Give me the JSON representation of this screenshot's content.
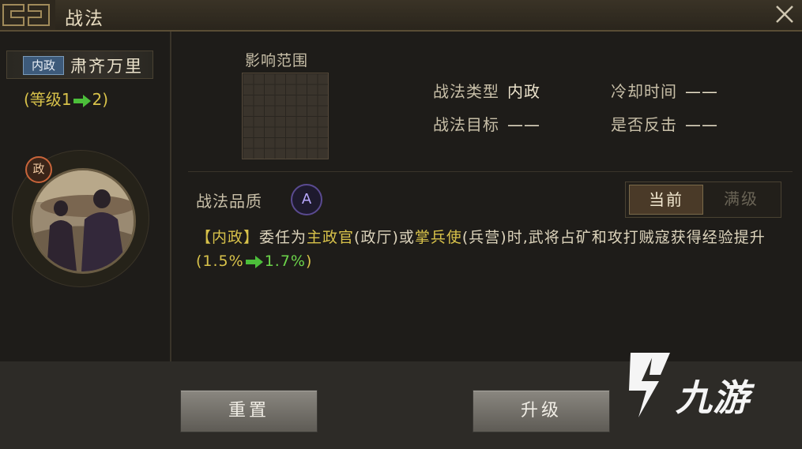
{
  "header": {
    "title": "战法"
  },
  "skill": {
    "tag": "内政",
    "name": "肃齐万里",
    "level_prefix": "(等级",
    "level_from": "1",
    "level_to": "2",
    "level_suffix": ")",
    "portrait_badge": "政"
  },
  "range": {
    "label": "影响范围"
  },
  "info": {
    "type_label": "战法类型",
    "type_value": "内政",
    "target_label": "战法目标",
    "target_value": "——",
    "cooldown_label": "冷却时间",
    "cooldown_value": "——",
    "counter_label": "是否反击",
    "counter_value": "——"
  },
  "quality": {
    "label": "战法品质",
    "grade": "A"
  },
  "tabs": {
    "current": "当前",
    "max": "满级"
  },
  "description": {
    "tag": "【内政】",
    "p1": "委任为",
    "role1": "主政官",
    "p2": "(政厅)或",
    "role2": "掌兵使",
    "p3": "(兵营)时,武将占矿和攻打贼寇获得经验提升",
    "open": "(",
    "from": "1.5%",
    "to": "1.7%",
    "close": ")"
  },
  "buttons": {
    "reset": "重置",
    "upgrade": "升级"
  },
  "watermark": {
    "text": "九游"
  },
  "colors": {
    "accent_yellow": "#d8c24a",
    "accent_green": "#6cd44a",
    "quality_purple": "#5a4a90"
  }
}
